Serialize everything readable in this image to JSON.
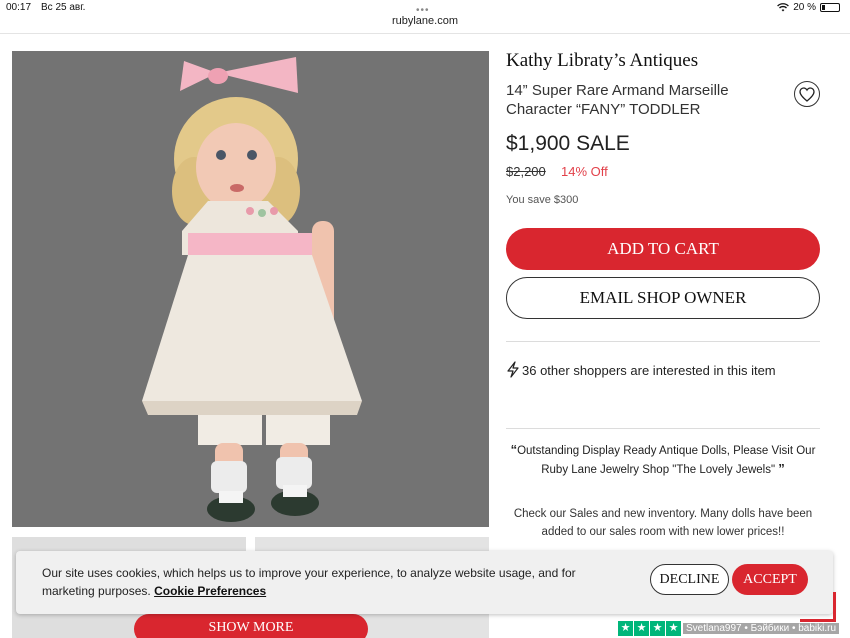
{
  "status_bar": {
    "time": "00:17",
    "date": "Вс 25 авг.",
    "battery": "20 %",
    "battery_fraction": 0.2
  },
  "browser": {
    "url": "rubylane.com",
    "menu_dots": "•••"
  },
  "product": {
    "shop_name": "Kathy Libraty’s Antiques",
    "title": "14” Super Rare Armand Marseille Character “FANY” TODDLER",
    "price": "$1,900 SALE",
    "old_price": "$2,200",
    "discount": "14% Off",
    "savings": "You save $300",
    "add_to_cart_label": "ADD TO CART",
    "email_label": "EMAIL SHOP OWNER",
    "interest_text": "36 other shoppers are interested in this item",
    "quote_open": "“",
    "quote_text": "Outstanding Display Ready Antique Dolls, Please Visit Our Ruby Lane Jewelry Shop \"The Lovely Jewels\"",
    "quote_close": "”",
    "note": "Check our Sales and new inventory. Many dolls have been added to our sales room with new lower prices!!",
    "show_more_label": "SHOW MORE"
  },
  "cookie_banner": {
    "text": "Our site uses cookies, which helps us to improve your experience, to analyze website usage, and for marketing purposes.",
    "link": "Cookie Preferences",
    "decline_label": "DECLINE",
    "accept_label": "ACCEPT"
  },
  "icons": {
    "heart": "heart-icon",
    "bolt": "lightning-icon",
    "wifi": "wifi-icon",
    "star": "★"
  },
  "watermark": "Svetlana997 • Бэйбики • babiki.ru",
  "colors": {
    "accent": "#d9262f",
    "discount": "#e2414a",
    "image_bg": "#737373",
    "trustpilot": "#00b67a"
  }
}
